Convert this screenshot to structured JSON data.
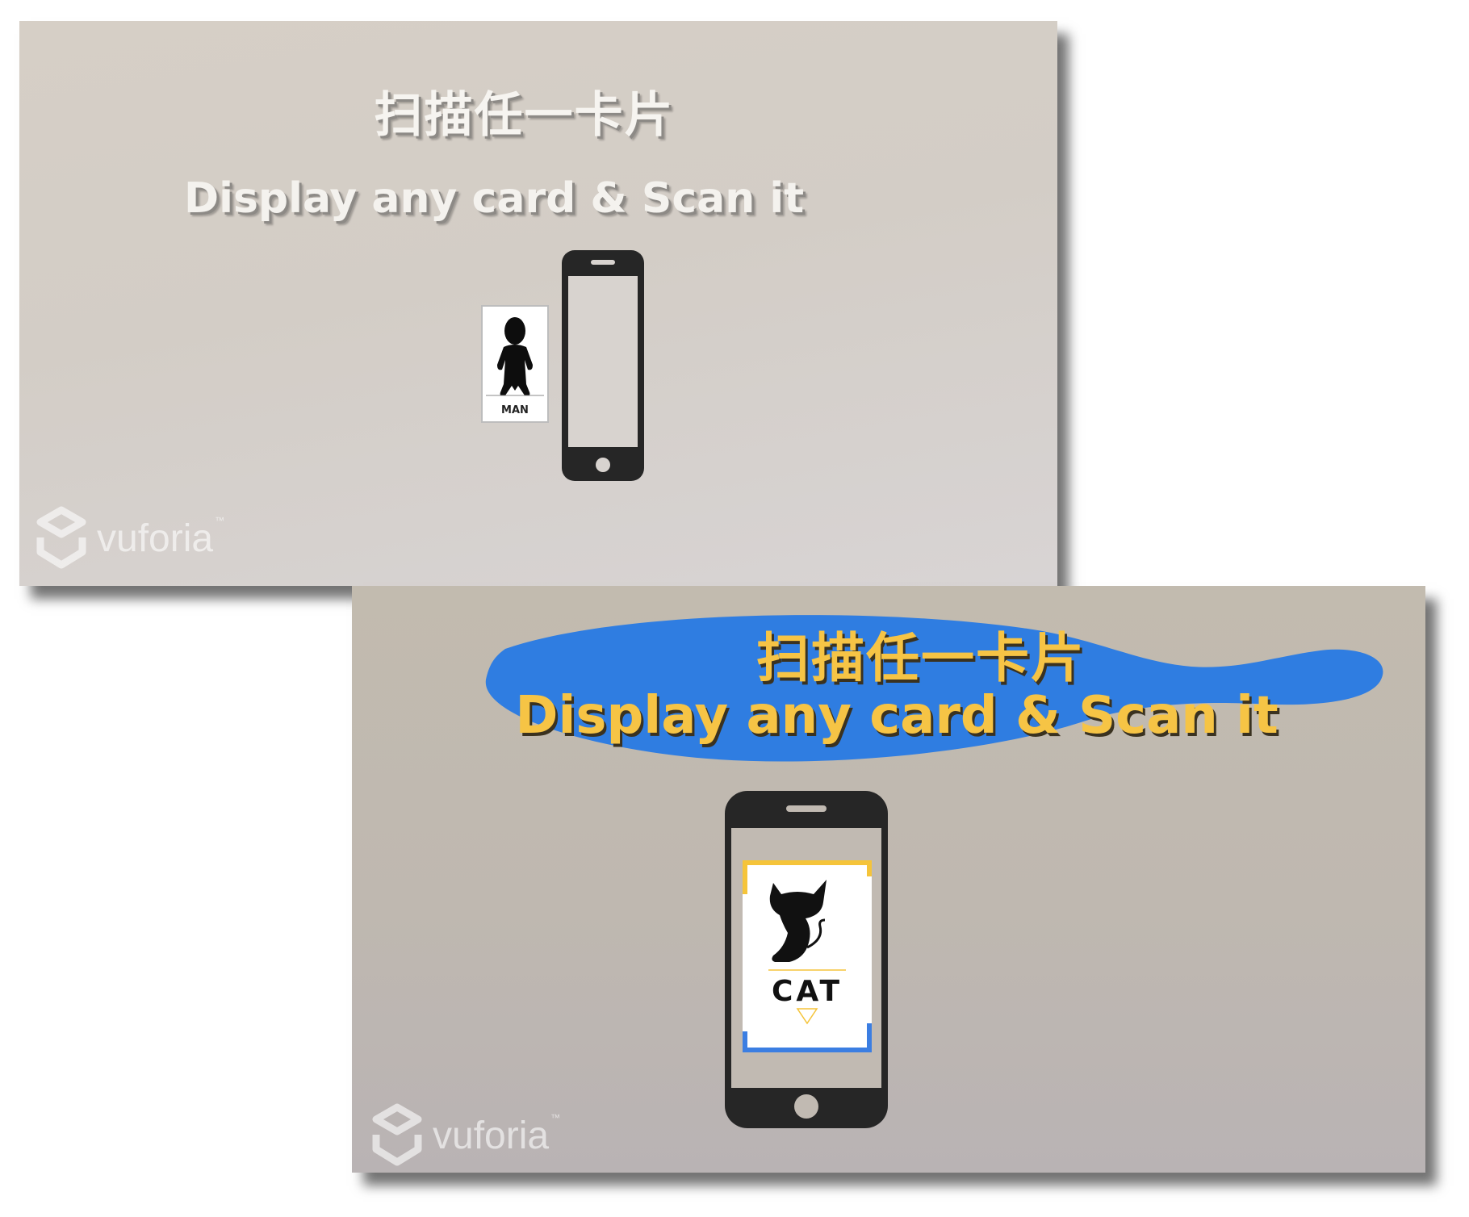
{
  "screens": [
    {
      "title_cn": "扫描任一卡片",
      "title_en": "Display any card & Scan it",
      "card_label": "MAN",
      "watermark": "vuforia",
      "watermark_tm": "™"
    },
    {
      "title_cn": "扫描任一卡片",
      "title_en": "Display any card & Scan it",
      "card_label": "CAT",
      "watermark": "vuforia",
      "watermark_tm": "™"
    }
  ],
  "colors": {
    "highlight_blue": "#2f7de1",
    "title_yellow": "#f6c445",
    "card_accent_yellow": "#f5c43a",
    "card_accent_blue": "#3b7ee2",
    "phone_dark": "#262626"
  },
  "icons": [
    "vuforia-logo-icon",
    "phone-icon",
    "man-silhouette-icon",
    "cat-silhouette-icon"
  ]
}
